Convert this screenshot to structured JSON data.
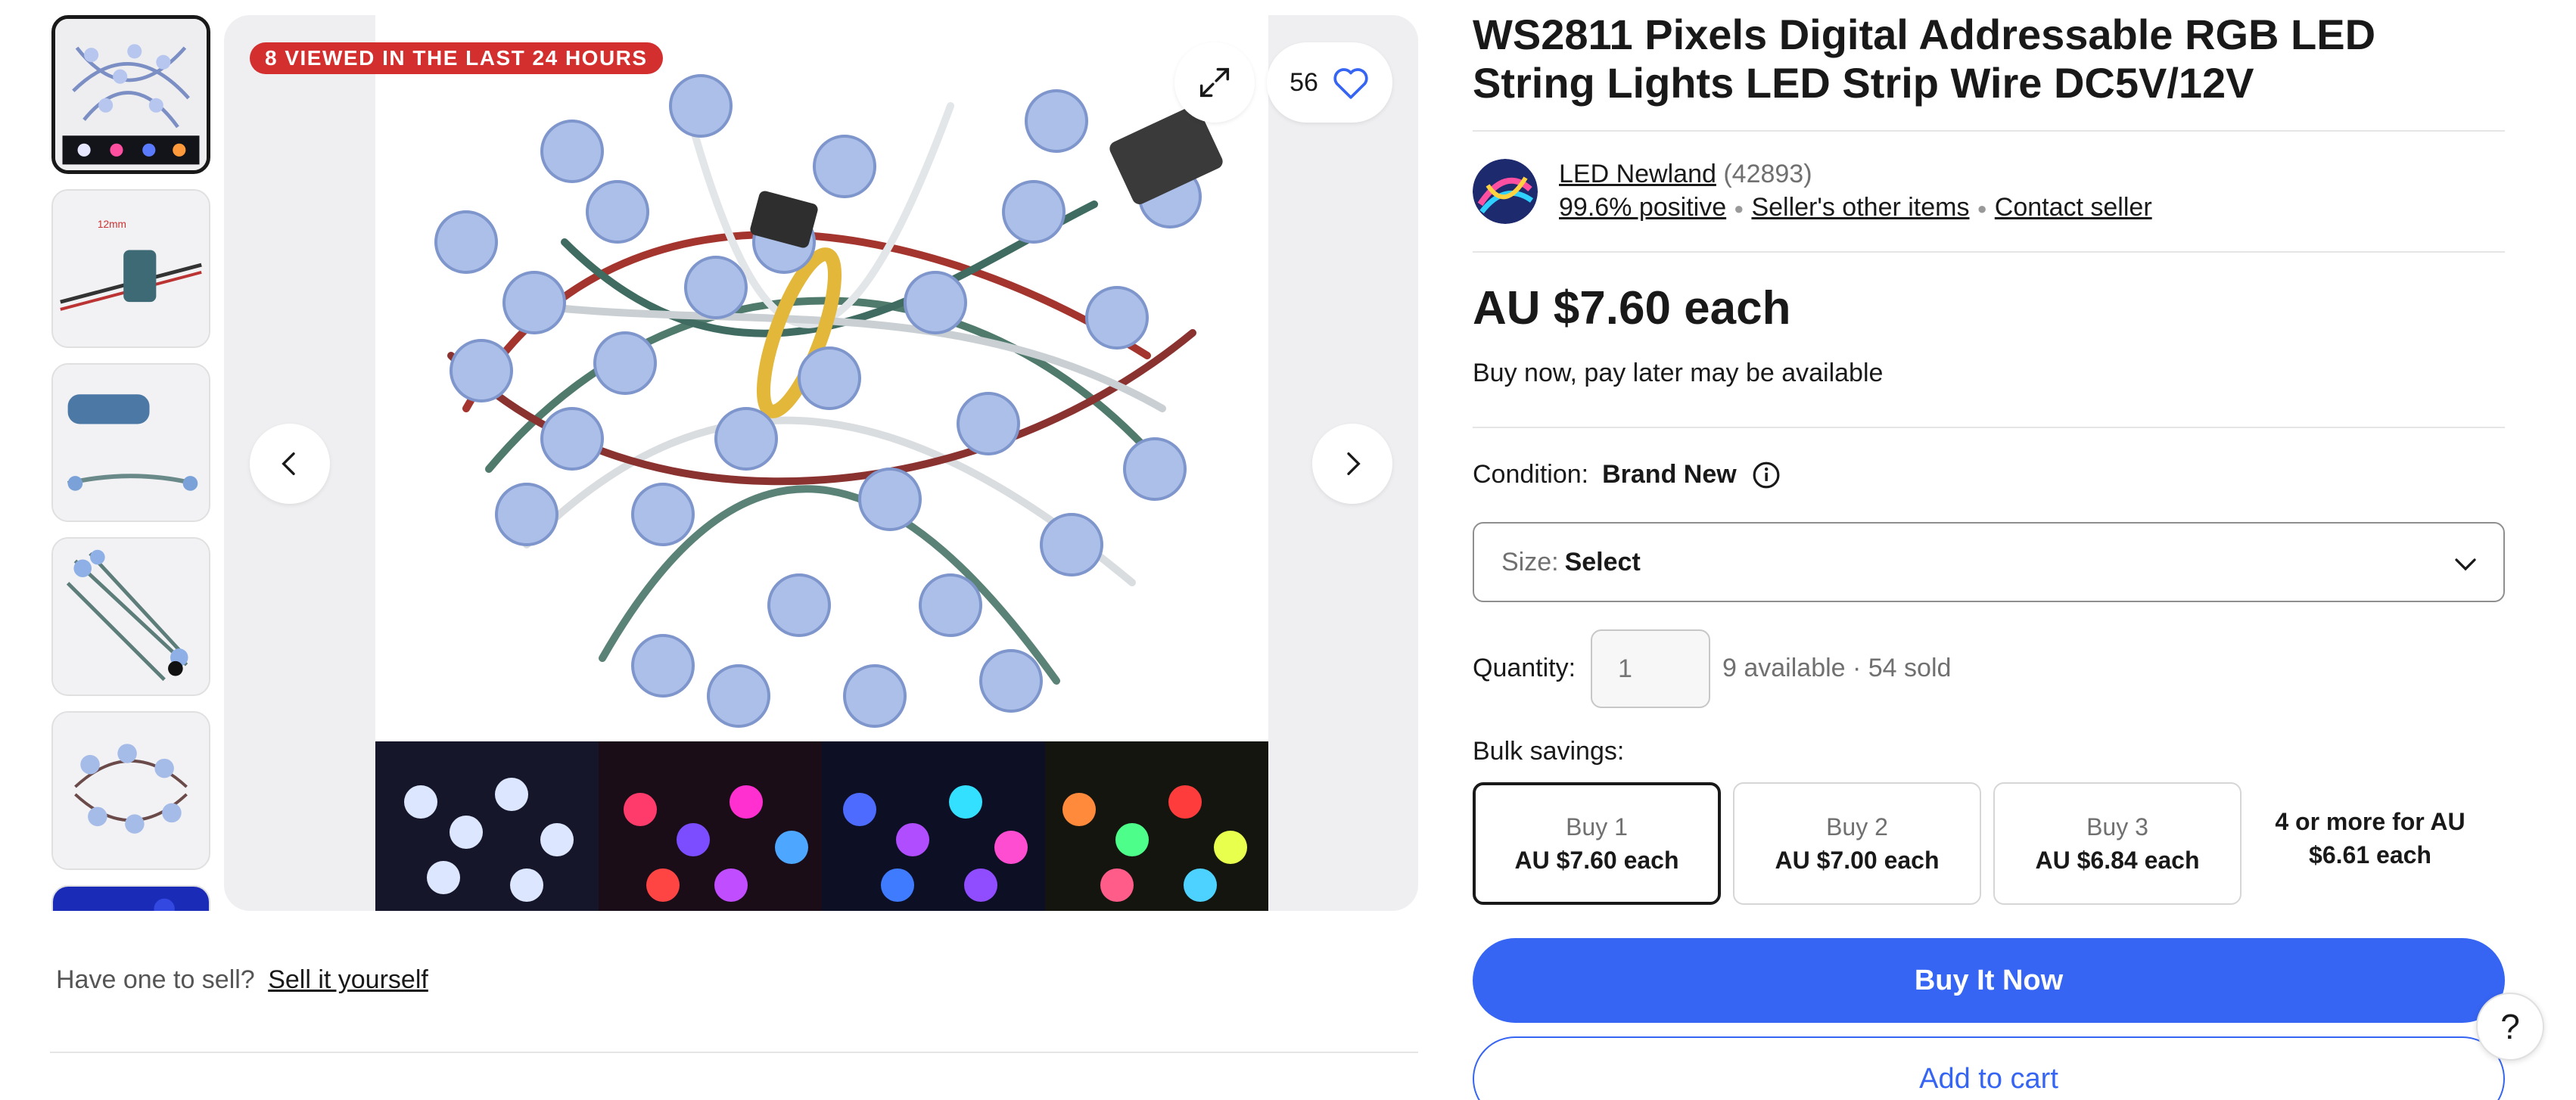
{
  "gallery": {
    "viewed_badge": "8 VIEWED IN THE LAST 24 HOURS",
    "watch_count": "56",
    "icons": {
      "expand": "expand-icon",
      "heart": "heart-icon",
      "prev": "chevron-left-icon",
      "next": "chevron-right-icon"
    },
    "thumbnails": [
      "thumbnail-1",
      "thumbnail-2",
      "thumbnail-3",
      "thumbnail-4",
      "thumbnail-5",
      "thumbnail-6"
    ],
    "active_thumbnail": 1
  },
  "sell_prompt": {
    "text": "Have one to sell?",
    "link": "Sell it yourself"
  },
  "product": {
    "title": "WS2811 Pixels Digital Addressable RGB LED String Lights LED Strip Wire DC5V/12V",
    "price": "AU $7.60 each",
    "pay_later": "Buy now, pay later may be available",
    "condition_label": "Condition:",
    "condition_value": "Brand New"
  },
  "seller": {
    "name": "LED Newland",
    "feedback_count": "(42893)",
    "positive": "99.6% positive",
    "other_items": "Seller's other items",
    "contact": "Contact seller"
  },
  "size": {
    "label": "Size:",
    "value": "Select"
  },
  "quantity": {
    "label": "Quantity:",
    "placeholder": "1",
    "availability": "9 available · 54 sold"
  },
  "bulk": {
    "label": "Bulk savings:",
    "options": [
      {
        "qty": "Buy 1",
        "price": "AU $7.60 each"
      },
      {
        "qty": "Buy 2",
        "price": "AU $7.00 each"
      },
      {
        "qty": "Buy 3",
        "price": "AU $6.84 each"
      }
    ],
    "more": "4 or more for AU $6.61 each"
  },
  "actions": {
    "buy_now": "Buy It Now",
    "add_to_cart": "Add to cart",
    "help": "?"
  },
  "colors": {
    "accent": "#3665f3",
    "badge": "#d32f2f",
    "text": "#191919"
  }
}
